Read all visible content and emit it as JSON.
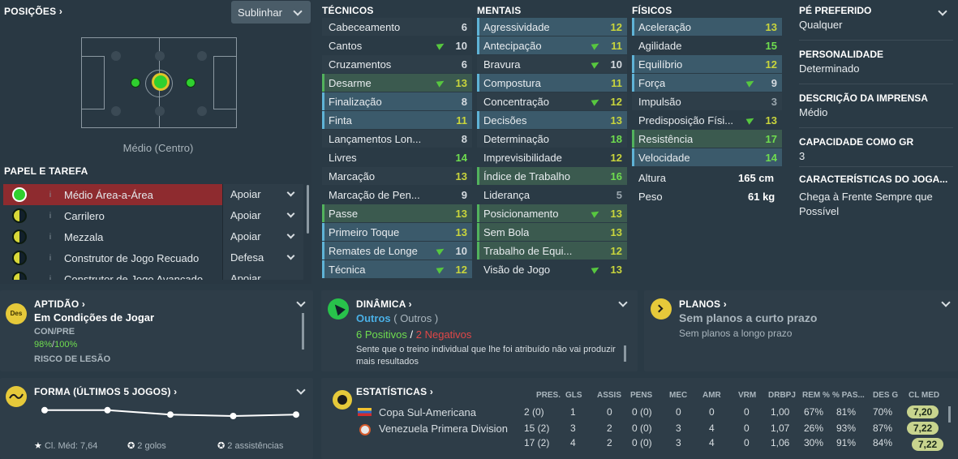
{
  "positions": {
    "title": "POSIÇÕES ›",
    "dropdown": "Sublinhar",
    "position_label": "Médio (Centro)"
  },
  "role_section": {
    "title": "PAPEL E TAREFA",
    "roles": [
      {
        "name": "Médio Área-a-Área",
        "duty": "Apoiar"
      },
      {
        "name": "Carrilero",
        "duty": "Apoiar"
      },
      {
        "name": "Mezzala",
        "duty": "Apoiar"
      },
      {
        "name": "Construtor de Jogo Recuado",
        "duty": "Defesa"
      },
      {
        "name": "Construtor de Jogo Avançado",
        "duty": "Apoiar"
      }
    ]
  },
  "tecnicos": {
    "title": "TÉCNICOS",
    "items": [
      {
        "label": "Cabeceamento",
        "value": "6"
      },
      {
        "label": "Cantos",
        "value": "10"
      },
      {
        "label": "Cruzamentos",
        "value": "6"
      },
      {
        "label": "Desarme",
        "value": "13"
      },
      {
        "label": "Finalização",
        "value": "8"
      },
      {
        "label": "Finta",
        "value": "11"
      },
      {
        "label": "Lançamentos Lon...",
        "value": "8"
      },
      {
        "label": "Livres",
        "value": "14"
      },
      {
        "label": "Marcação",
        "value": "13"
      },
      {
        "label": "Marcação de Pen...",
        "value": "9"
      },
      {
        "label": "Passe",
        "value": "13"
      },
      {
        "label": "Primeiro Toque",
        "value": "13"
      },
      {
        "label": "Remates de Longe",
        "value": "10"
      },
      {
        "label": "Técnica",
        "value": "12"
      }
    ]
  },
  "mentais": {
    "title": "MENTAIS",
    "items": [
      {
        "label": "Agressividade",
        "value": "12"
      },
      {
        "label": "Antecipação",
        "value": "11"
      },
      {
        "label": "Bravura",
        "value": "10"
      },
      {
        "label": "Compostura",
        "value": "11"
      },
      {
        "label": "Concentração",
        "value": "12"
      },
      {
        "label": "Decisões",
        "value": "13"
      },
      {
        "label": "Determinação",
        "value": "18"
      },
      {
        "label": "Imprevisibilidade",
        "value": "12"
      },
      {
        "label": "Índice de Trabalho",
        "value": "16"
      },
      {
        "label": "Liderança",
        "value": "5"
      },
      {
        "label": "Posicionamento",
        "value": "13"
      },
      {
        "label": "Sem Bola",
        "value": "13"
      },
      {
        "label": "Trabalho de Equi...",
        "value": "12"
      },
      {
        "label": "Visão de Jogo",
        "value": "13"
      }
    ]
  },
  "fisicos": {
    "title": "FÍSICOS",
    "items": [
      {
        "label": "Aceleração",
        "value": "13"
      },
      {
        "label": "Agilidade",
        "value": "15"
      },
      {
        "label": "Equilíbrio",
        "value": "12"
      },
      {
        "label": "Força",
        "value": "9"
      },
      {
        "label": "Impulsão",
        "value": "3"
      },
      {
        "label": "Predisposição Físi...",
        "value": "13"
      },
      {
        "label": "Resistência",
        "value": "17"
      },
      {
        "label": "Velocidade",
        "value": "14"
      }
    ],
    "altura_label": "Altura",
    "altura": "165 cm",
    "peso_label": "Peso",
    "peso": "61 kg"
  },
  "side": {
    "pe_label": "PÉ PREFERIDO",
    "pe": "Qualquer",
    "pers_label": "PERSONALIDADE",
    "pers": "Determinado",
    "imprensa_label": "DESCRIÇÃO DA IMPRENSA",
    "imprensa": "Médio",
    "gr_label": "CAPACIDADE COMO GR",
    "gr": "3",
    "carac_label": "CARACTERÍSTICAS DO JOGA...",
    "carac": "Chega à Frente Sempre que Possível"
  },
  "aptidao": {
    "title": "APTIDÃO ›",
    "badge": "Des",
    "status": "Em Condições de Jogar",
    "conpre_label": "CON/PRE",
    "con": "98%",
    "pre": "100%",
    "risco": "RISCO DE LESÃO"
  },
  "dinamica": {
    "title": "DINÂMICA ›",
    "group": "Outros",
    "group2": "( Outros )",
    "pos": "6 Positivos",
    "sep": "/",
    "neg": "2 Negativos",
    "text": "Sente que o treino individual que lhe foi atribuído não vai produzir mais resultados"
  },
  "planos": {
    "title": "PLANOS ›",
    "short": "Sem planos a curto prazo",
    "long": "Sem planos a longo prazo"
  },
  "forma": {
    "title": "FORMA (ÚLTIMOS 5 JOGOS) ›",
    "cl": "Cl. Méd: 7,64",
    "golos": "2 golos",
    "assist": "2 assistências",
    "chart_data": {
      "type": "line",
      "values": [
        7.6,
        7.6,
        7.3,
        7.2,
        7.3
      ]
    }
  },
  "estatisticas": {
    "title": "ESTATÍSTICAS ›",
    "headers": [
      "PRES.",
      "GLS",
      "ASSIS",
      "PENS",
      "MEC",
      "AMR",
      "VRM",
      "DRBPJ",
      "REM %",
      "% PAS...",
      "DES G",
      "CL MED"
    ],
    "rows": [
      {
        "comp": "Copa Sul-Americana",
        "cells": [
          "2 (0)",
          "1",
          "0",
          "0 (0)",
          "0",
          "0",
          "0",
          "1,00",
          "67%",
          "81%",
          "70%"
        ],
        "cl": "7,20"
      },
      {
        "comp": "Venezuela Primera Division",
        "cells": [
          "15 (2)",
          "3",
          "2",
          "0 (0)",
          "3",
          "4",
          "0",
          "1,07",
          "26%",
          "93%",
          "87%"
        ],
        "cl": "7,22"
      },
      {
        "comp": "",
        "cells": [
          "17 (2)",
          "4",
          "2",
          "0 (0)",
          "3",
          "4",
          "0",
          "1,06",
          "30%",
          "91%",
          "84%"
        ],
        "cl": "7,22"
      }
    ]
  },
  "colors": {
    "accent_green": "#6fdd4f",
    "accent_red": "#e04747",
    "accent_blue": "#4ab0e6"
  }
}
